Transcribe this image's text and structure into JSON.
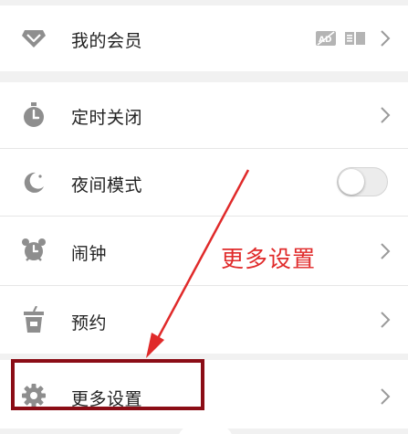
{
  "menu": {
    "items": [
      {
        "label": "我的会员",
        "icon": "diamond-icon"
      },
      {
        "label": "定时关闭",
        "icon": "timer-icon"
      },
      {
        "label": "夜间模式",
        "icon": "moon-icon",
        "toggle": "off"
      },
      {
        "label": "闹钟",
        "icon": "alarm-clock-icon"
      },
      {
        "label": "预约",
        "icon": "cup-icon"
      },
      {
        "label": "更多设置",
        "icon": "gear-icon"
      }
    ]
  },
  "annotation": {
    "text": "更多设置"
  },
  "colors": {
    "icon_gray": "#8e8e8e",
    "annotation_red": "#e02a2a",
    "highlight_dark_red": "#8b0d16"
  }
}
